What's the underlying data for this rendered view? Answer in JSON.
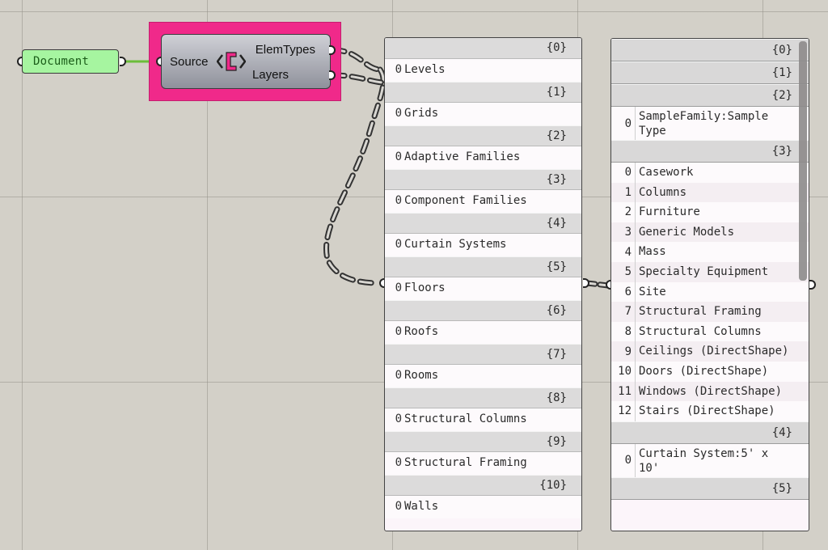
{
  "document_param": {
    "label": "Document"
  },
  "component": {
    "input": "Source",
    "outputs": [
      "ElemTypes",
      "Layers"
    ]
  },
  "panel_left": {
    "branches": [
      {
        "path": "{0}",
        "items": [
          {
            "index": "0",
            "text": "Levels"
          }
        ]
      },
      {
        "path": "{1}",
        "items": [
          {
            "index": "0",
            "text": "Grids"
          }
        ]
      },
      {
        "path": "{2}",
        "items": [
          {
            "index": "0",
            "text": "Adaptive Families"
          }
        ]
      },
      {
        "path": "{3}",
        "items": [
          {
            "index": "0",
            "text": "Component Families"
          }
        ]
      },
      {
        "path": "{4}",
        "items": [
          {
            "index": "0",
            "text": "Curtain Systems"
          }
        ]
      },
      {
        "path": "{5}",
        "items": [
          {
            "index": "0",
            "text": "Floors"
          }
        ]
      },
      {
        "path": "{6}",
        "items": [
          {
            "index": "0",
            "text": "Roofs"
          }
        ]
      },
      {
        "path": "{7}",
        "items": [
          {
            "index": "0",
            "text": "Rooms"
          }
        ]
      },
      {
        "path": "{8}",
        "items": [
          {
            "index": "0",
            "text": "Structural Columns"
          }
        ]
      },
      {
        "path": "{9}",
        "items": [
          {
            "index": "0",
            "text": "Structural Framing"
          }
        ]
      },
      {
        "path": "{10}",
        "items": [
          {
            "index": "0",
            "text": "Walls"
          }
        ]
      }
    ]
  },
  "panel_right": {
    "branches": [
      {
        "path": "{0}",
        "items": []
      },
      {
        "path": "{1}",
        "items": []
      },
      {
        "path": "{2}",
        "items": [
          {
            "index": "0",
            "text": "SampleFamily:Sample Type"
          }
        ]
      },
      {
        "path": "{3}",
        "items": [
          {
            "index": "0",
            "text": "Casework"
          },
          {
            "index": "1",
            "text": "Columns"
          },
          {
            "index": "2",
            "text": "Furniture"
          },
          {
            "index": "3",
            "text": "Generic Models"
          },
          {
            "index": "4",
            "text": "Mass"
          },
          {
            "index": "5",
            "text": "Specialty Equipment"
          },
          {
            "index": "6",
            "text": "Site"
          },
          {
            "index": "7",
            "text": "Structural Framing"
          },
          {
            "index": "8",
            "text": "Structural Columns"
          },
          {
            "index": "9",
            "text": "Ceilings (DirectShape)"
          },
          {
            "index": "10",
            "text": "Doors (DirectShape)"
          },
          {
            "index": "11",
            "text": "Windows (DirectShape)"
          },
          {
            "index": "12",
            "text": "Stairs (DirectShape)"
          }
        ]
      },
      {
        "path": "{4}",
        "items": [
          {
            "index": "0",
            "text": "Curtain System:5' x 10'"
          }
        ]
      },
      {
        "path": "{5}",
        "items": []
      }
    ]
  },
  "colors": {
    "component_highlight": "#f0298a",
    "param_fill": "#a6f5a0",
    "canvas": "#d3d0c8"
  }
}
